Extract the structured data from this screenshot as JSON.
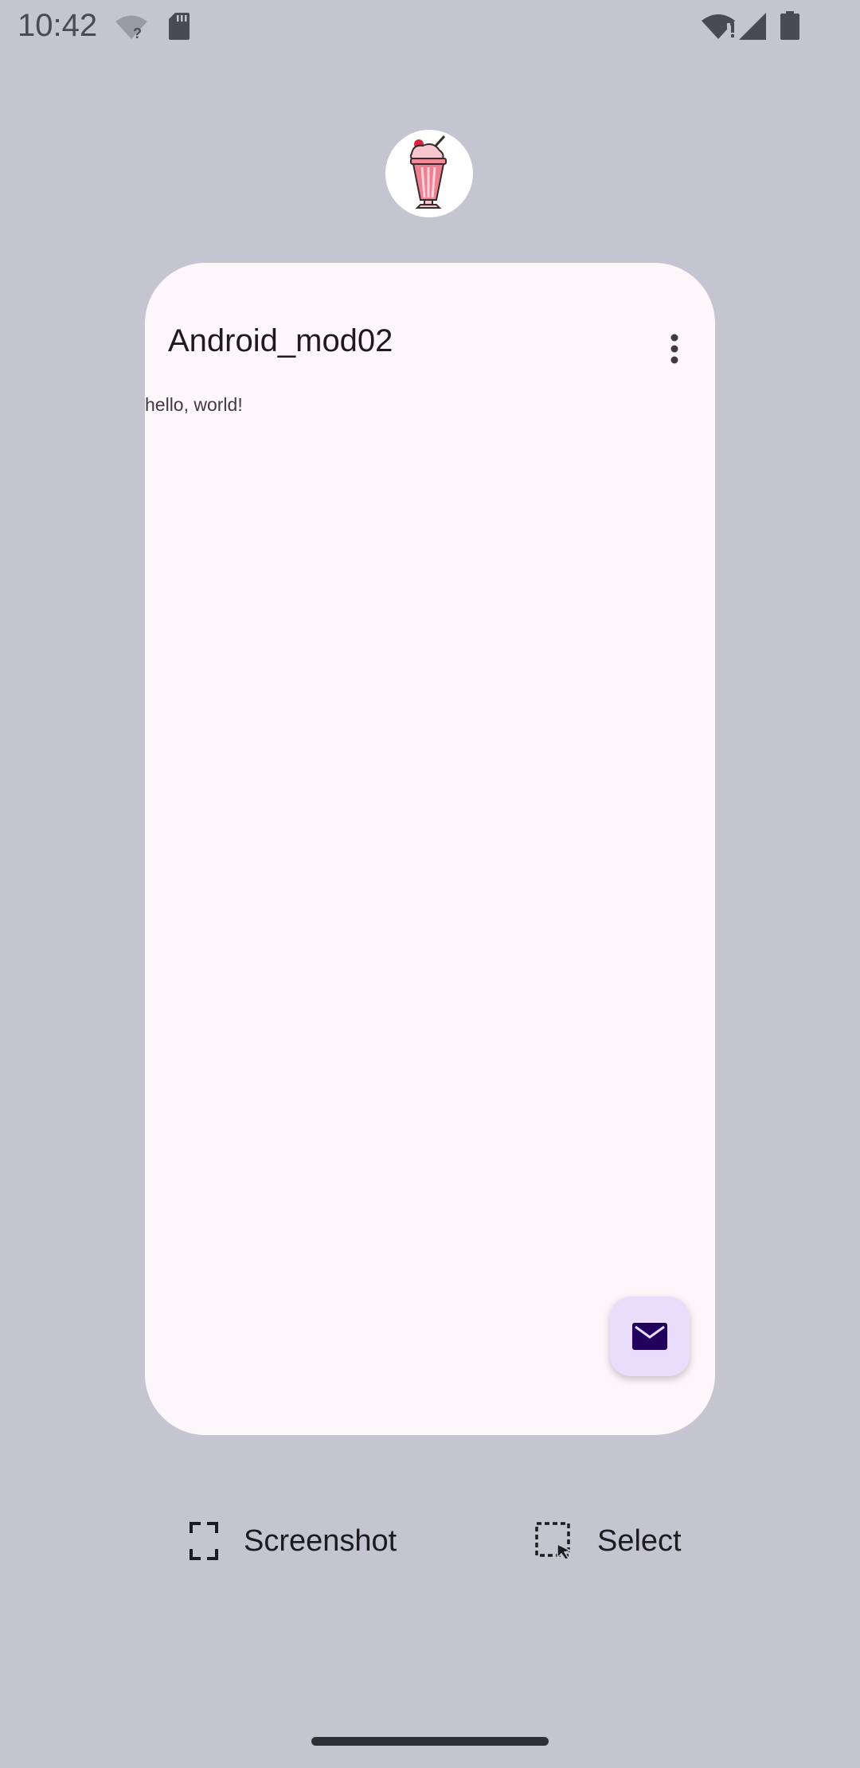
{
  "status_bar": {
    "time": "10:42",
    "icons": [
      "wifi-question-icon",
      "sd-card-icon",
      "wifi-alert-icon",
      "cell-signal-icon",
      "battery-icon"
    ]
  },
  "recents": {
    "app_icon": "milkshake-app-icon",
    "app": {
      "title": "Android_mod02",
      "overflow_icon": "more-vert-icon",
      "body_text": "hello, world!",
      "fab_icon": "mail-icon"
    },
    "actions": {
      "screenshot_label": "Screenshot",
      "select_label": "Select"
    }
  },
  "colors": {
    "background": "#c5c5d1",
    "card": "#fdf7fc",
    "fab": "#eaddfc",
    "fab_icon": "#21005d"
  }
}
